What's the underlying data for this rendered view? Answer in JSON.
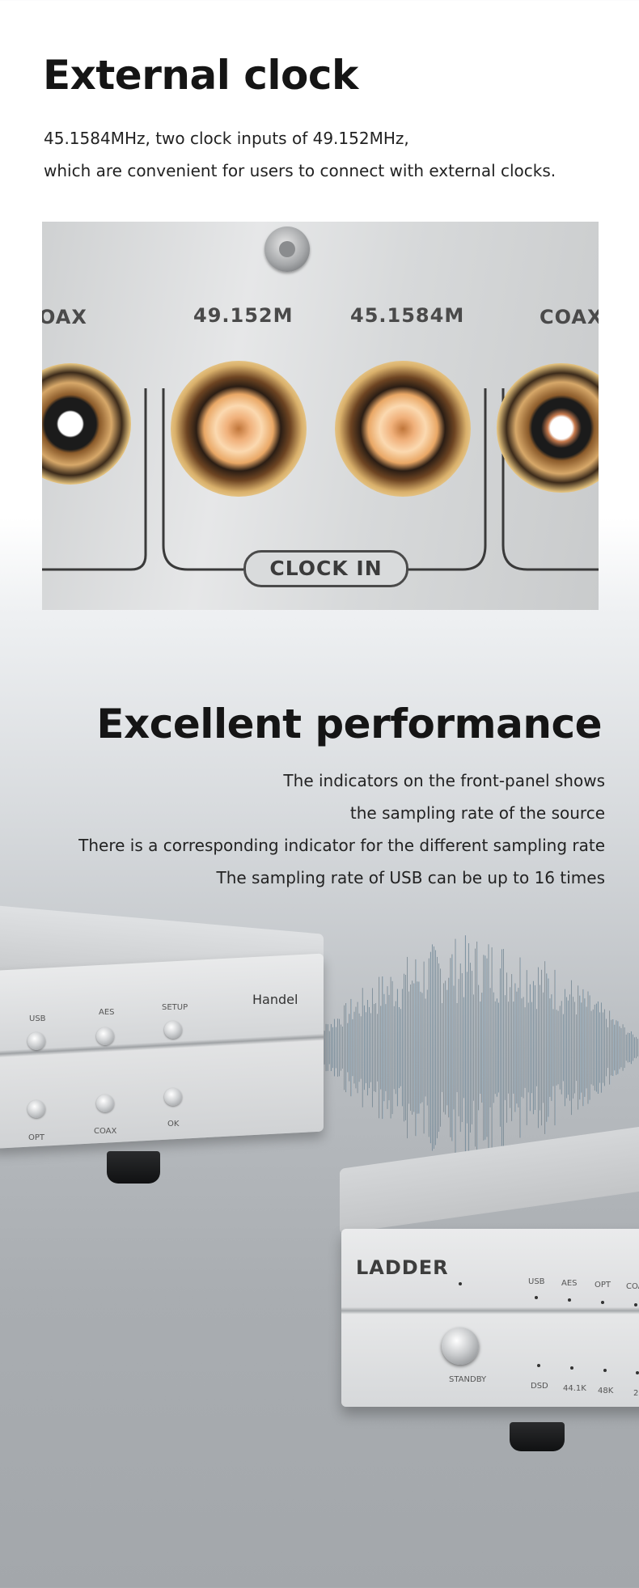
{
  "section1": {
    "title": "External clock",
    "lines": [
      "45.1584MHz, two clock inputs of 49.152MHz,",
      "which are convenient for users to connect with external clocks."
    ]
  },
  "clock_photo": {
    "labels": [
      "OAX",
      "49.152M",
      "45.1584M",
      "COAX"
    ],
    "group_label": "CLOCK IN"
  },
  "section2": {
    "title": "Excellent performance",
    "lines": [
      "The indicators on the front-panel shows",
      "the sampling rate of the source",
      "There is a corresponding indicator for the different sampling rate",
      "The sampling rate of USB can be up to 16 times"
    ]
  },
  "device_handel": {
    "brand": "Handel",
    "top_buttons": [
      "USB",
      "AES",
      "SETUP"
    ],
    "bottom_buttons": [
      "OPT",
      "COAX",
      "OK"
    ]
  },
  "device_ladder": {
    "brand": "LADDER",
    "standby": "STANDBY",
    "top_indicators": [
      "USB",
      "AES",
      "OPT",
      "COA"
    ],
    "bottom_indicators": [
      "DSD",
      "44.1K",
      "48K",
      "2"
    ]
  }
}
